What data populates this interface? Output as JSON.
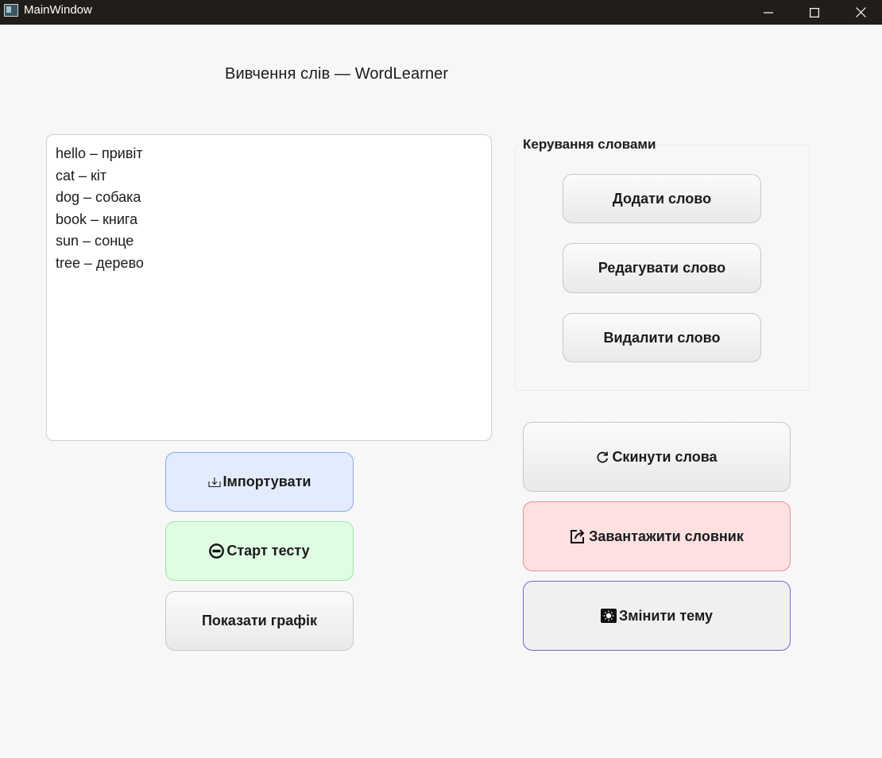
{
  "window": {
    "title": "MainWindow"
  },
  "header": {
    "title": "Вивчення слів — WordLearner"
  },
  "word_list": {
    "items": [
      "hello – привіт",
      "cat – кіт",
      "dog – собака",
      "book – книга",
      "sun – сонце",
      "tree – дерево"
    ]
  },
  "manage_group": {
    "title": "Керування словами",
    "add_label": "Додати слово",
    "edit_label": "Редагувати слово",
    "delete_label": "Видалити слово"
  },
  "left_actions": {
    "import_label": "Імпортувати",
    "import_icon": "import-icon",
    "start_test_label": "Старт тесту",
    "start_test_icon": "no-entry-icon",
    "show_chart_label": "Показати графік"
  },
  "right_actions": {
    "reset_label": "Скинути слова",
    "reset_icon": "refresh-icon",
    "download_label": "Завантажити словник",
    "download_icon": "export-icon",
    "theme_label": "Змінити тему",
    "theme_icon": "sun-icon"
  },
  "colors": {
    "import_bg": "#e3ecfd",
    "start_bg": "#e0fde3",
    "download_bg": "#fee0e1",
    "theme_border": "#6a6ad4"
  }
}
